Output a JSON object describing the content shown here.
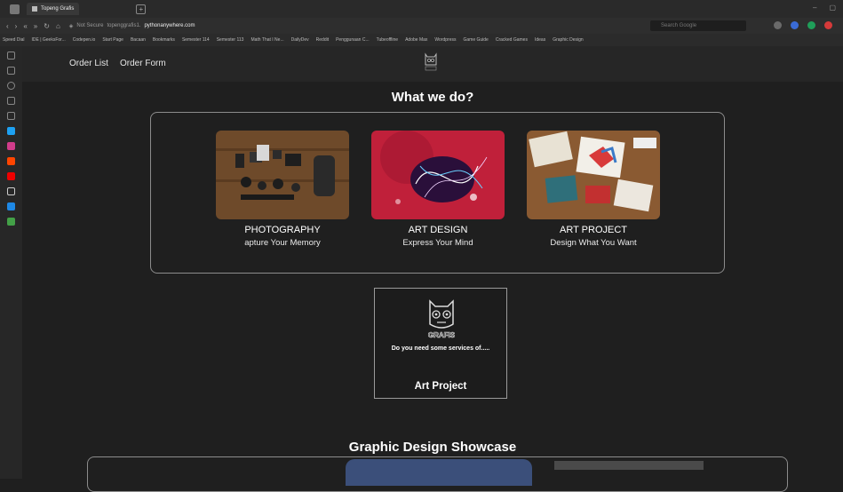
{
  "browser": {
    "tab_title": "Topeng Grafis",
    "not_secure": "Not Secure",
    "url_prefix": "topenggrafis1.",
    "url_host": "pythonanywhere.com",
    "search_placeholder": "Search Google"
  },
  "bookmarks": [
    "Speed Dial",
    "IDE | GeeksFor...",
    "Codepen.io",
    "Start Page",
    "Bacaan",
    "Bookmarks",
    "Semester 114",
    "Semester 113",
    "Math That I Ne...",
    "DailyDev",
    "Reddit",
    "Penggunaan C...",
    "Tubeoffline",
    "Adobe Max",
    "Wordpress",
    "Game Guide",
    "Cracked Games",
    "Ideas",
    "Graphic Design"
  ],
  "nav": {
    "order_list": "Order List",
    "order_form": "Order Form"
  },
  "section_title": "What we do?",
  "services": [
    {
      "title": "PHOTOGRAPHY",
      "subtitle": "apture Your Memory"
    },
    {
      "title": "ART DESIGN",
      "subtitle": "Express Your Mind"
    },
    {
      "title": "ART PROJECT",
      "subtitle": "Design What You Want"
    }
  ],
  "aside": {
    "question": "Do you need some services of.....",
    "service_name": "Art Project",
    "logo_text": "GRAFIS"
  },
  "showcase_title": "Graphic Design Showcase",
  "colors": {
    "page_bg": "#1f1f1f",
    "nav_bg": "#262626",
    "border": "#8c8c8c",
    "showcase_blue": "#3b4f7a"
  }
}
